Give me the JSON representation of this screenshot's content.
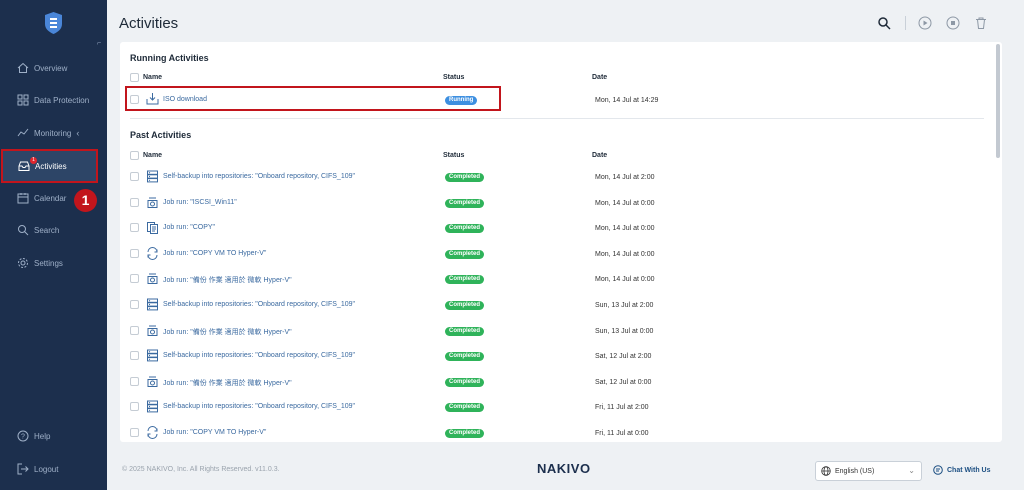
{
  "sidebar": {
    "items": [
      {
        "label": "Overview",
        "icon": "home-icon"
      },
      {
        "label": "Data Protection",
        "icon": "grid-icon"
      },
      {
        "label": "Monitoring",
        "icon": "chart-icon"
      },
      {
        "label": "Activities",
        "icon": "inbox-icon",
        "badge": "1"
      },
      {
        "label": "Calendar",
        "icon": "calendar-icon"
      },
      {
        "label": "Search",
        "icon": "search-icon"
      },
      {
        "label": "Settings",
        "icon": "gear-icon"
      }
    ],
    "help": "Help",
    "logout": "Logout",
    "step_marker": "1"
  },
  "header": {
    "title": "Activities"
  },
  "running": {
    "title": "Running Activities",
    "columns": {
      "name": "Name",
      "status": "Status",
      "date": "Date"
    },
    "rows": [
      {
        "name": "ISO download",
        "status": "Running",
        "date": "Mon, 14 Jul at 14:29",
        "icon": "download-icon"
      }
    ]
  },
  "past": {
    "title": "Past Activities",
    "columns": {
      "name": "Name",
      "status": "Status",
      "date": "Date"
    },
    "rows": [
      {
        "name": "Self-backup into repositories: \"Onboard repository, CIFS_109\"",
        "status": "Completed",
        "date": "Mon, 14 Jul at 2:00",
        "icon": "server-icon"
      },
      {
        "name": "Job run: \"ISCSI_Win11\"",
        "status": "Completed",
        "date": "Mon, 14 Jul at 0:00",
        "icon": "job-run-icon"
      },
      {
        "name": "Job run: \"COPY\"",
        "status": "Completed",
        "date": "Mon, 14 Jul at 0:00",
        "icon": "copy-job-icon"
      },
      {
        "name": "Job run: \"COPY VM TO Hyper-V\"",
        "status": "Completed",
        "date": "Mon, 14 Jul at 0:00",
        "icon": "replication-icon"
      },
      {
        "name": "Job run: \"備份 作業 適用於 微軟 Hyper-V\"",
        "status": "Completed",
        "date": "Mon, 14 Jul at 0:00",
        "icon": "job-run-icon"
      },
      {
        "name": "Self-backup into repositories: \"Onboard repository, CIFS_109\"",
        "status": "Completed",
        "date": "Sun, 13 Jul at 2:00",
        "icon": "server-icon"
      },
      {
        "name": "Job run: \"備份 作業 適用於 微軟 Hyper-V\"",
        "status": "Completed",
        "date": "Sun, 13 Jul at 0:00",
        "icon": "job-run-icon"
      },
      {
        "name": "Self-backup into repositories: \"Onboard repository, CIFS_109\"",
        "status": "Completed",
        "date": "Sat, 12 Jul at 2:00",
        "icon": "server-icon"
      },
      {
        "name": "Job run: \"備份 作業 適用於 微軟 Hyper-V\"",
        "status": "Completed",
        "date": "Sat, 12 Jul at 0:00",
        "icon": "job-run-icon"
      },
      {
        "name": "Self-backup into repositories: \"Onboard repository, CIFS_109\"",
        "status": "Completed",
        "date": "Fri, 11 Jul at 2:00",
        "icon": "server-icon"
      },
      {
        "name": "Job run: \"COPY VM TO Hyper-V\"",
        "status": "Completed",
        "date": "Fri, 11 Jul at 0:00",
        "icon": "replication-icon"
      }
    ]
  },
  "footer": {
    "copyright": "© 2025 NAKIVO, Inc. All Rights Reserved. v11.0.3.",
    "brand": "NAKIVO",
    "language": "English (US)",
    "chat": "Chat With Us"
  },
  "colors": {
    "sidebar_bg": "#1c2f4d",
    "completed": "#2fb35a",
    "running": "#3d8fe0",
    "highlight": "#c2151c"
  }
}
